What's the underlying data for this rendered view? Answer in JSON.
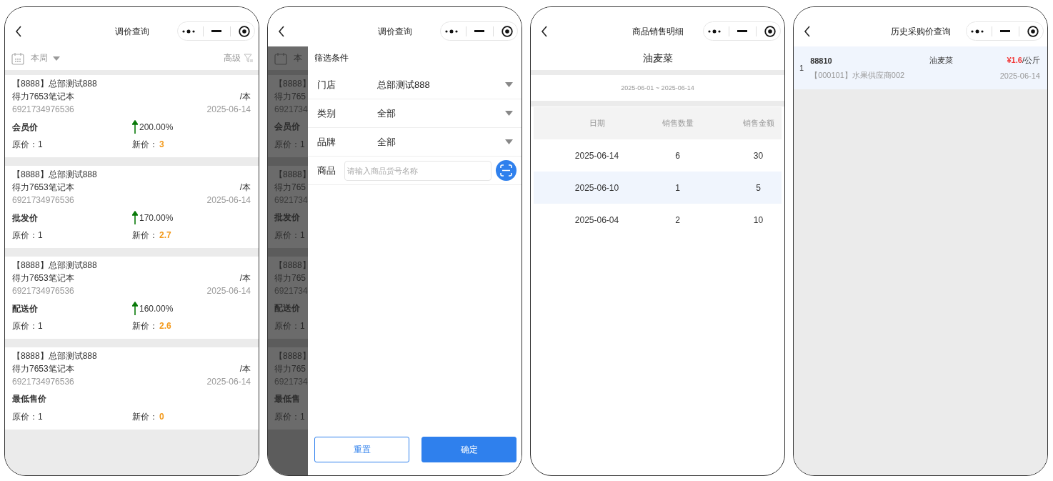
{
  "phones": [
    {
      "kind": "price_list",
      "title": "调价查询",
      "period": "本周",
      "advanced": "高级",
      "cards": [
        {
          "store": "【8888】总部测试888",
          "product": "得力7653笔记本",
          "unit": "/本",
          "barcode": "6921734976536",
          "date": "2025-06-14",
          "price_type": "会员价",
          "change": "200.00%",
          "original": "原价：1",
          "new_label": "新价：",
          "new_value": "3"
        },
        {
          "store": "【8888】总部测试888",
          "product": "得力7653笔记本",
          "unit": "/本",
          "barcode": "6921734976536",
          "date": "2025-06-14",
          "price_type": "批发价",
          "change": "170.00%",
          "original": "原价：1",
          "new_label": "新价：",
          "new_value": "2.7"
        },
        {
          "store": "【8888】总部测试888",
          "product": "得力7653笔记本",
          "unit": "/本",
          "barcode": "6921734976536",
          "date": "2025-06-14",
          "price_type": "配送价",
          "change": "160.00%",
          "original": "原价：1",
          "new_label": "新价：",
          "new_value": "2.6"
        },
        {
          "store": "【8888】总部测试888",
          "product": "得力7653笔记本",
          "unit": "/本",
          "barcode": "6921734976536",
          "date": "2025-06-14",
          "price_type": "最低售价",
          "original": "原价：1",
          "new_label": "新价：",
          "new_value": "0"
        }
      ]
    },
    {
      "kind": "filter",
      "title": "调价查询",
      "background": {
        "period": "本",
        "cards": [
          {
            "store": "【8888】",
            "product": "得力765",
            "barcode": "6921734",
            "price_type": "会员价",
            "original": "原价：1"
          },
          {
            "store": "【8888】",
            "product": "得力765",
            "barcode": "6921734",
            "price_type": "批发价",
            "original": "原价：1"
          },
          {
            "store": "【8888】",
            "product": "得力765",
            "barcode": "6921734",
            "price_type": "配送价",
            "original": "原价：1"
          },
          {
            "store": "【8888】",
            "product": "得力765",
            "barcode": "6921734",
            "price_type": "最低售",
            "original": "原价：1"
          }
        ]
      },
      "drawer": {
        "heading": "筛选条件",
        "fields": [
          {
            "kind": "select",
            "label": "门店",
            "value": "总部测试888"
          },
          {
            "kind": "select",
            "label": "类别",
            "value": "全部"
          },
          {
            "kind": "select",
            "label": "品牌",
            "value": "全部"
          },
          {
            "kind": "search",
            "label": "商品",
            "placeholder": "请输入商品货号名称"
          }
        ],
        "buttons": [
          {
            "kind": "secondary",
            "label": "重置"
          },
          {
            "kind": "primary",
            "label": "确定"
          }
        ]
      }
    },
    {
      "kind": "sales_detail",
      "title": "商品销售明细",
      "product": "油麦菜",
      "range": "2025-06-01 ~ 2025-06-14",
      "table": {
        "columns": [
          "日期",
          "销售数量",
          "销售金额"
        ],
        "rows": [
          {
            "cells": [
              "2025-06-14",
              "6",
              "30"
            ],
            "selected": false
          },
          {
            "cells": [
              "2025-06-10",
              "1",
              "5"
            ],
            "selected": true
          },
          {
            "cells": [
              "2025-06-04",
              "2",
              "10"
            ],
            "selected": false
          }
        ]
      }
    },
    {
      "kind": "purchase_history",
      "title": "历史采购价查询",
      "records": [
        {
          "index": "1",
          "code": "88810",
          "name": "油麦菜",
          "price": "¥1.6",
          "unit": "/公斤",
          "supplier": "【000101】水果供应商002",
          "date": "2025-06-14"
        }
      ]
    }
  ]
}
